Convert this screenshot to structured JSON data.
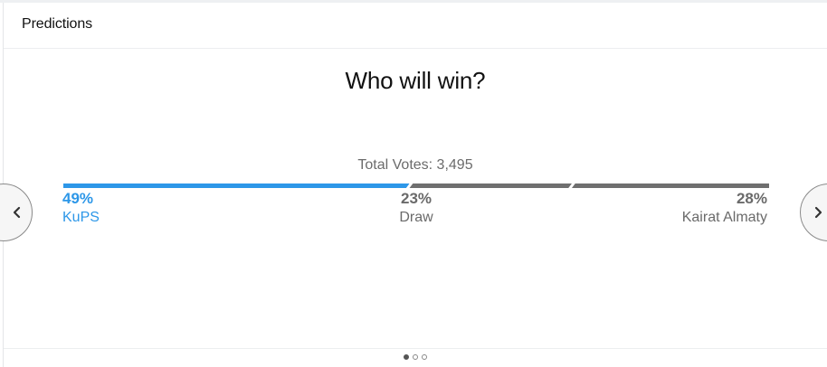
{
  "widget": {
    "title": "Predictions"
  },
  "poll": {
    "question": "Who will win?",
    "total_votes": "Total Votes: 3,495",
    "outcomes": [
      {
        "key": "home",
        "percent": 49,
        "percent_label": "49%",
        "label": "KuPS",
        "color": "#2d97e8"
      },
      {
        "key": "draw",
        "percent": 23,
        "percent_label": "23%",
        "label": "Draw",
        "color": "#6f6f6f"
      },
      {
        "key": "away",
        "percent": 28,
        "percent_label": "28%",
        "label": "Kairat Almaty",
        "color": "#6f6f6f"
      }
    ]
  },
  "navigation": {
    "prev_icon": "chevron-left-icon",
    "next_icon": "chevron-right-icon"
  },
  "pagination": {
    "pages": 3,
    "current": 1
  },
  "colors": {
    "accent": "#2d97e8",
    "neutral_bar": "#6f6f6f",
    "text": "#111111"
  }
}
